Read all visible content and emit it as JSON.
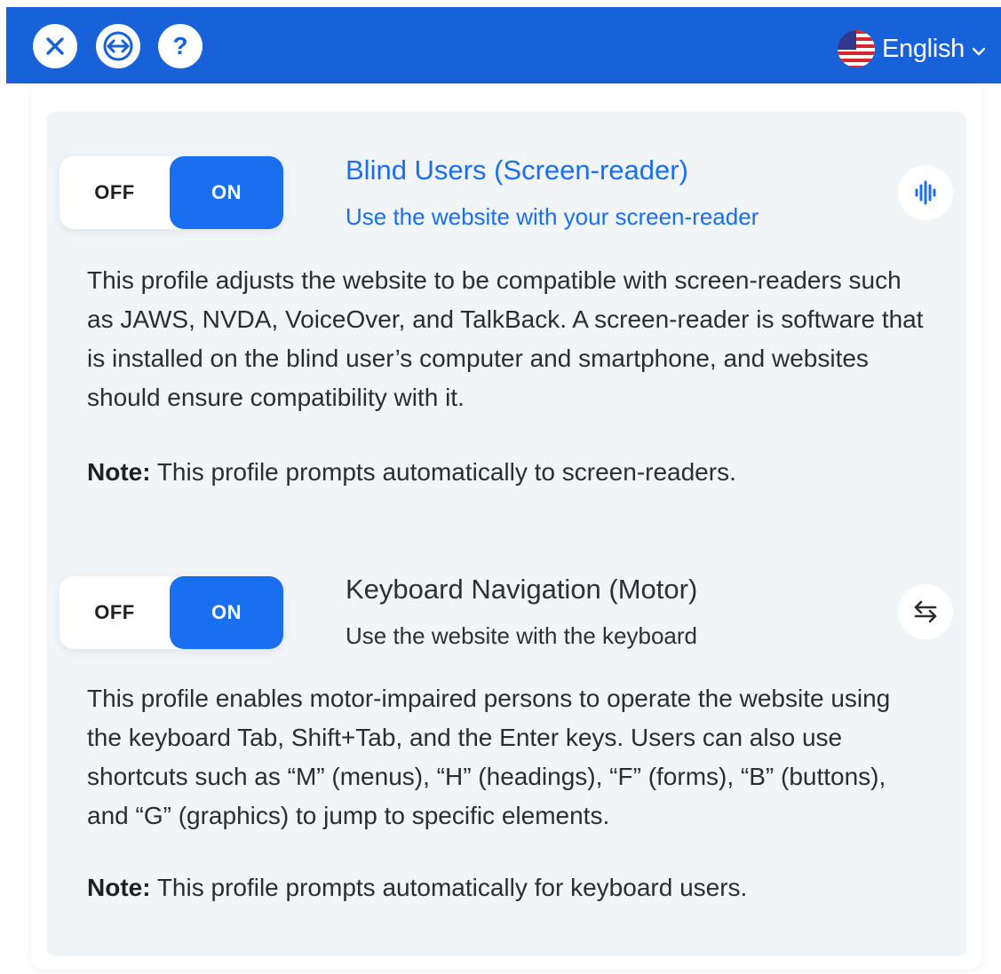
{
  "header": {
    "close_icon": "close-icon",
    "oversize_icon": "horizontal-arrows-icon",
    "help_icon": "help-icon",
    "help_glyph": "?",
    "language": {
      "flag_icon": "us-flag-icon",
      "label": "English",
      "chevron_icon": "chevron-down-icon"
    },
    "colors": {
      "bar": "#1761d9",
      "button_bg": "#ffffff"
    }
  },
  "profiles": [
    {
      "toggle": {
        "off_label": "OFF",
        "on_label": "ON",
        "state": "on"
      },
      "title": "Blind Users (Screen-reader)",
      "subtitle": "Use the website with your screen-reader",
      "icon": "audio-wave-icon",
      "description": "This profile adjusts the website to be compatible with screen-readers such as JAWS, NVDA, VoiceOver, and TalkBack. A screen-reader is software that is installed on the blind user’s computer and smartphone, and websites should ensure compatibility with it.",
      "note_label": "Note:",
      "note_text": " This profile prompts automatically to screen-readers."
    },
    {
      "toggle": {
        "off_label": "OFF",
        "on_label": "ON",
        "state": "on"
      },
      "title": "Keyboard Navigation (Motor)",
      "subtitle": "Use the website with the keyboard",
      "icon": "swap-arrows-icon",
      "description": "This profile enables motor-impaired persons to operate the website using the keyboard Tab, Shift+Tab, and the Enter keys. Users can also use shortcuts such as “M” (menus), “H” (headings), “F” (forms), “B” (buttons), and “G” (graphics) to jump to specific elements.",
      "note_label": "Note:",
      "note_text": " This profile prompts automatically for keyboard users."
    }
  ],
  "colors": {
    "accent": "#1a6ff0",
    "card_bg": "#f1f5f8"
  }
}
